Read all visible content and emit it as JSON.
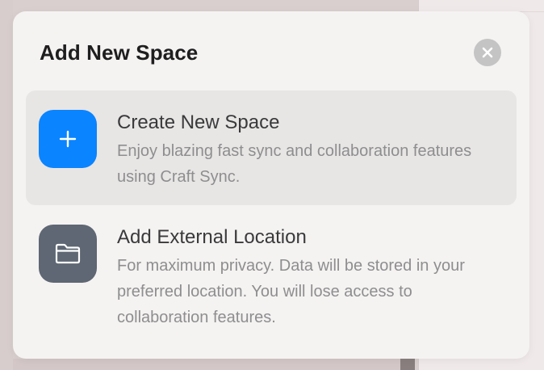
{
  "modal": {
    "title": "Add New Space",
    "close_icon": "close-icon"
  },
  "options": [
    {
      "title": "Create New Space",
      "description": "Enjoy blazing fast sync and collaboration features using Craft Sync.",
      "icon": "plus-icon",
      "icon_color": "#0a84ff",
      "selected": true
    },
    {
      "title": "Add External Location",
      "description": "For maximum privacy. Data will be stored in your preferred location. You will lose access to collaboration features.",
      "icon": "folder-icon",
      "icon_color": "#5e6773",
      "selected": false
    }
  ]
}
